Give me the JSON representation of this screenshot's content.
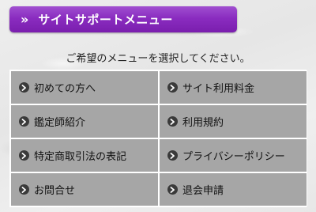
{
  "header": {
    "icon": "double-chevron-right-icon",
    "icon_glyph": "»",
    "title": "サイトサポートメニュー",
    "color": "#8a2cc0"
  },
  "instruction": "ご希望のメニューを選択してください。",
  "menu": {
    "item_bg": "#a6a6a6",
    "icon": "circle-chevron-right-icon",
    "items": [
      {
        "label": "初めての方へ"
      },
      {
        "label": "サイト利用料金"
      },
      {
        "label": "鑑定師紹介"
      },
      {
        "label": "利用規約"
      },
      {
        "label": "特定商取引法の表記"
      },
      {
        "label": "プライバシーポリシー"
      },
      {
        "label": "お問合せ"
      },
      {
        "label": "退会申請"
      }
    ]
  }
}
